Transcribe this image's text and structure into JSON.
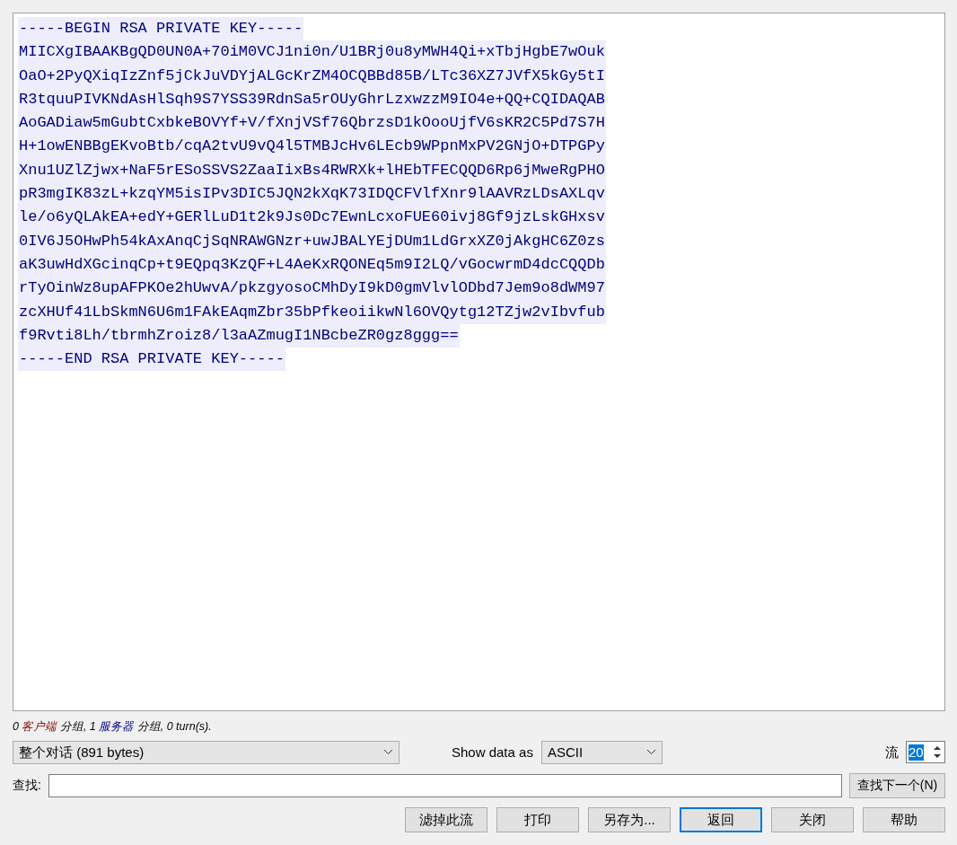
{
  "stream": {
    "lines": [
      "-----BEGIN RSA PRIVATE KEY-----",
      "MIICXgIBAAKBgQD0UN0A+70iM0VCJ1ni0n/U1BRj0u8yMWH4Qi+xTbjHgbE7wOuk",
      "OaO+2PyQXiqIzZnf5jCkJuVDYjALGcKrZM4OCQBBd85B/LTc36XZ7JVfX5kGy5tI",
      "R3tquuPIVKNdAsHlSqh9S7YSS39RdnSa5rOUyGhrLzxwzzM9IO4e+QQ+CQIDAQAB",
      "AoGADiaw5mGubtCxbkeBOVYf+V/fXnjVSf76QbrzsD1kOooUjfV6sKR2C5Pd7S7H",
      "H+1owENBBgEKvoBtb/cqA2tvU9vQ4l5TMBJcHv6LEcb9WPpnMxPV2GNjO+DTPGPy",
      "Xnu1UZlZjwx+NaF5rESoSSVS2ZaaIixBs4RWRXk+lHEbTFECQQD6Rp6jMweRgPHO",
      "pR3mgIK83zL+kzqYM5isIPv3DIC5JQN2kXqK73IDQCFVlfXnr9lAAVRzLDsAXLqv",
      "le/o6yQLAkEA+edY+GERlLuD1t2k9Js0Dc7EwnLcxoFUE60ivj8Gf9jzLskGHxsv",
      "0IV6J5OHwPh54kAxAnqCjSqNRAWGNzr+uwJBALYEjDUm1LdGrxXZ0jAkgHC6Z0zs",
      "aK3uwHdXGcinqCp+t9EQpq3KzQF+L4AeKxRQONEq5m9I2LQ/vGocwrmD4dcCQQDb",
      "rTyOinWz8upAFPKOe2hUwvA/pkzgyosoCMhDyI9kD0gmVlvlODbd7Jem9o8dWM97",
      "zcXHUf41LbSkmN6U6m1FAkEAqmZbr35bPfkeoiikwNl6OVQytg12TZjw2vIbvfub",
      "f9Rvti8Lh/tbrmhZroiz8/l3aAZmugI1NBcbeZR0gz8ggg==",
      "-----END RSA PRIVATE KEY-----"
    ]
  },
  "summary": [
    {
      "text": "0 ",
      "kind": "plain"
    },
    {
      "text": "客户端",
      "kind": "client"
    },
    {
      "text": " 分组, 1 ",
      "kind": "plain"
    },
    {
      "text": "服务器",
      "kind": "server"
    },
    {
      "text": " 分组, 0 turn(s).",
      "kind": "plain"
    }
  ],
  "conversation_select": {
    "value": "整个对话 (891 bytes)"
  },
  "show_as": {
    "label": "Show data as",
    "value": "ASCII"
  },
  "stream_number": {
    "label": "流",
    "value": "20"
  },
  "find": {
    "label": "查找:",
    "button": "查找下一个(N)"
  },
  "buttons": [
    {
      "label": "滤掉此流",
      "selected": false
    },
    {
      "label": "打印",
      "selected": false
    },
    {
      "label": "另存为...",
      "selected": false
    },
    {
      "label": "返回",
      "selected": true
    },
    {
      "label": "关闭",
      "selected": false
    },
    {
      "label": "帮助",
      "selected": false
    }
  ]
}
